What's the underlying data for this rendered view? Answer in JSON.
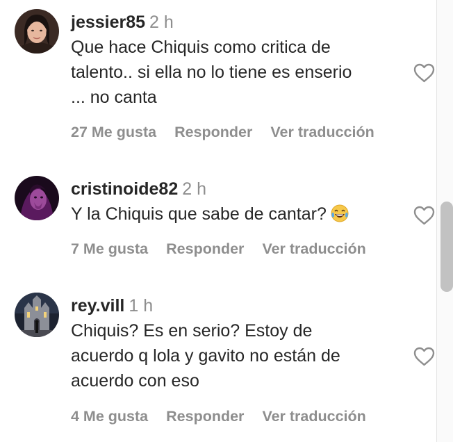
{
  "comments": [
    {
      "username": "jessier85",
      "time": "2 h",
      "text_lines": [
        "Que hace Chiquis como critica de",
        "talento.. si ella no lo tiene es enserio",
        "... no canta"
      ],
      "likes": "27 Me gusta",
      "reply": "Responder",
      "translate": "Ver traducción"
    },
    {
      "username": "cristinoide82",
      "time": "2 h",
      "text_lines": [
        "Y la Chiquis que sabe de cantar?"
      ],
      "emoji": "laughing-tears-emoji",
      "likes": "7 Me gusta",
      "reply": "Responder",
      "translate": "Ver traducción"
    },
    {
      "username": "rey.vill",
      "time": "1 h",
      "text_lines": [
        "Chiquis? Es en serio? Estoy de",
        "acuerdo q lola y gavito no están de",
        "acuerdo con eso"
      ],
      "likes": "4 Me gusta",
      "reply": "Responder",
      "translate": "Ver traducción"
    }
  ],
  "colors": {
    "text": "#262626",
    "secondary": "#8e8e8e",
    "heart_outline": "#8e8e8e",
    "scrollbar_thumb": "#c2c2c2"
  },
  "icons": {
    "like": "heart-outline-icon"
  }
}
